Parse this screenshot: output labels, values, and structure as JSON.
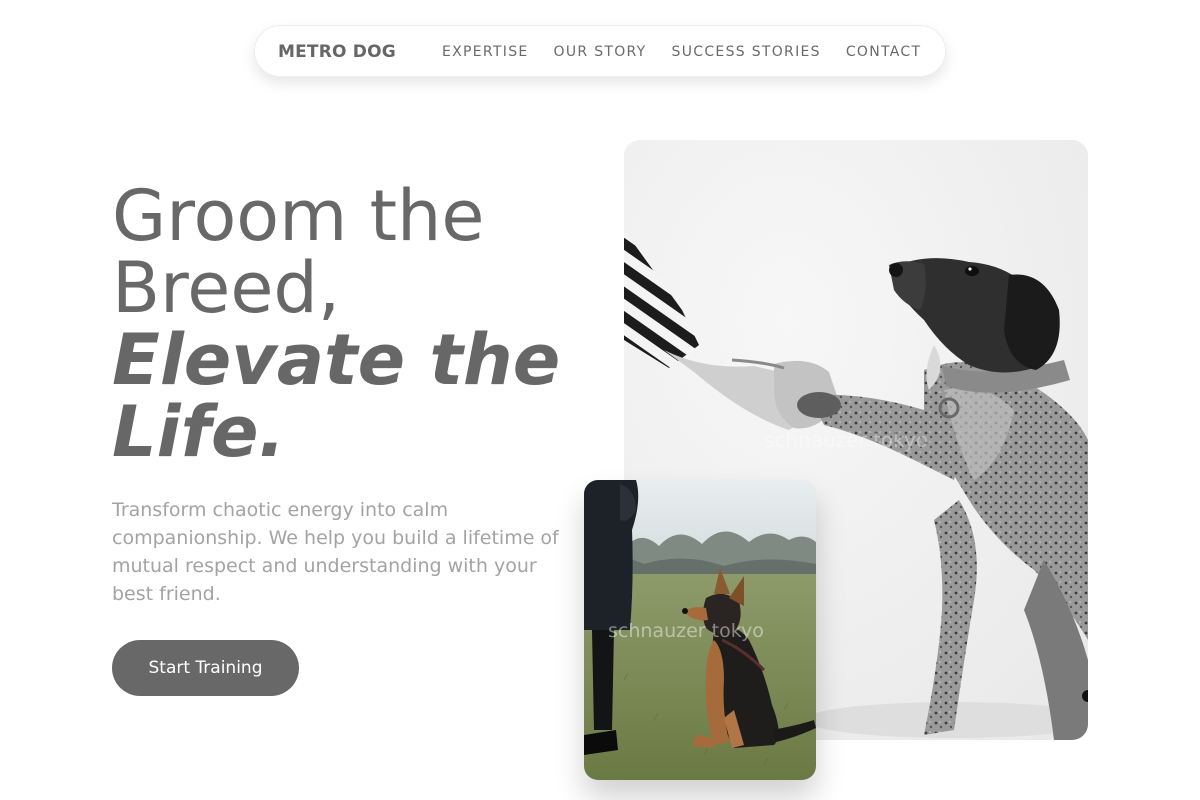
{
  "nav": {
    "brand": "METRO DOG",
    "links": [
      "EXPERTISE",
      "OUR STORY",
      "SUCCESS STORIES",
      "CONTACT"
    ]
  },
  "hero": {
    "headline_line1": "Groom the",
    "headline_line2": "Breed,",
    "headline_emph_line1": "Elevate the",
    "headline_emph_line2": "Life.",
    "description": "Transform chaotic energy into calm companionship. We help you build a lifetime of mutual respect and understanding with your best friend.",
    "cta_label": "Start Training"
  },
  "images": {
    "main_alt": "Black and white photo of a dog giving its paw to a person's hand",
    "main_watermark": "schnauzer tokyo",
    "inset_alt": "German Shepherd puppy sitting on grass looking up at its owner",
    "inset_watermark": "schnauzer tokyo"
  },
  "colors": {
    "text_primary": "#686868",
    "text_muted": "#a3a3a3",
    "button_bg": "#686868",
    "button_text": "#ffffff",
    "background": "#ffffff"
  }
}
